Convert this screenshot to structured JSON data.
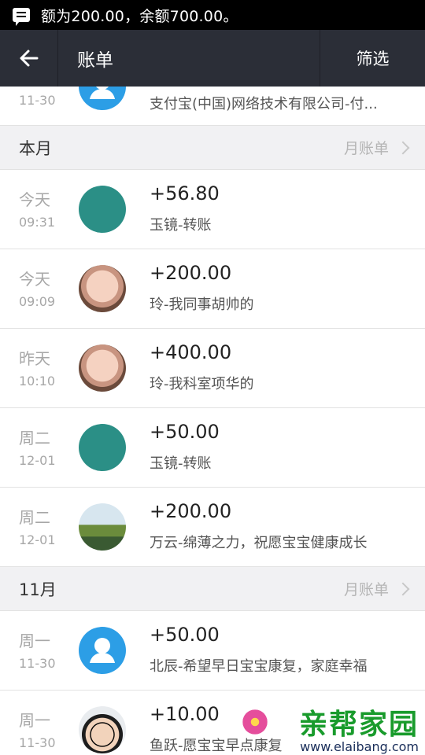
{
  "status_bar": {
    "message": "额为200.00，余额700.00。"
  },
  "app_bar": {
    "title": "账单",
    "filter_label": "筛选"
  },
  "partial_row": {
    "date": "11-30",
    "description": "支付宝(中国)网络技术有限公司-付..."
  },
  "sections": [
    {
      "title": "本月",
      "link": "月账单",
      "rows": [
        {
          "day": "今天",
          "time": "09:31",
          "amount": "+56.80",
          "description": "玉镜-转账",
          "avatar": "cartoon"
        },
        {
          "day": "今天",
          "time": "09:09",
          "amount": "+200.00",
          "description": "玲-我同事胡帅的",
          "avatar": "face"
        },
        {
          "day": "昨天",
          "time": "10:10",
          "amount": "+400.00",
          "description": "玲-我科室项华的",
          "avatar": "face"
        },
        {
          "day": "周二",
          "time": "12-01",
          "amount": "+50.00",
          "description": "玉镜-转账",
          "avatar": "cartoon"
        },
        {
          "day": "周二",
          "time": "12-01",
          "amount": "+200.00",
          "description": "万云-绵薄之力，祝愿宝宝健康成长",
          "avatar": "landscape"
        }
      ]
    },
    {
      "title": "11月",
      "link": "月账单",
      "rows": [
        {
          "day": "周一",
          "time": "11-30",
          "amount": "+50.00",
          "description": "北辰-希望早日宝宝康复，家庭幸福",
          "avatar": "default"
        },
        {
          "day": "周一",
          "time": "11-30",
          "amount": "+10.00",
          "description": "鱼跃-愿宝宝早点康复",
          "avatar": "man"
        }
      ]
    }
  ],
  "watermark": {
    "title": "亲帮家园",
    "url": "www.elaibang.com"
  }
}
